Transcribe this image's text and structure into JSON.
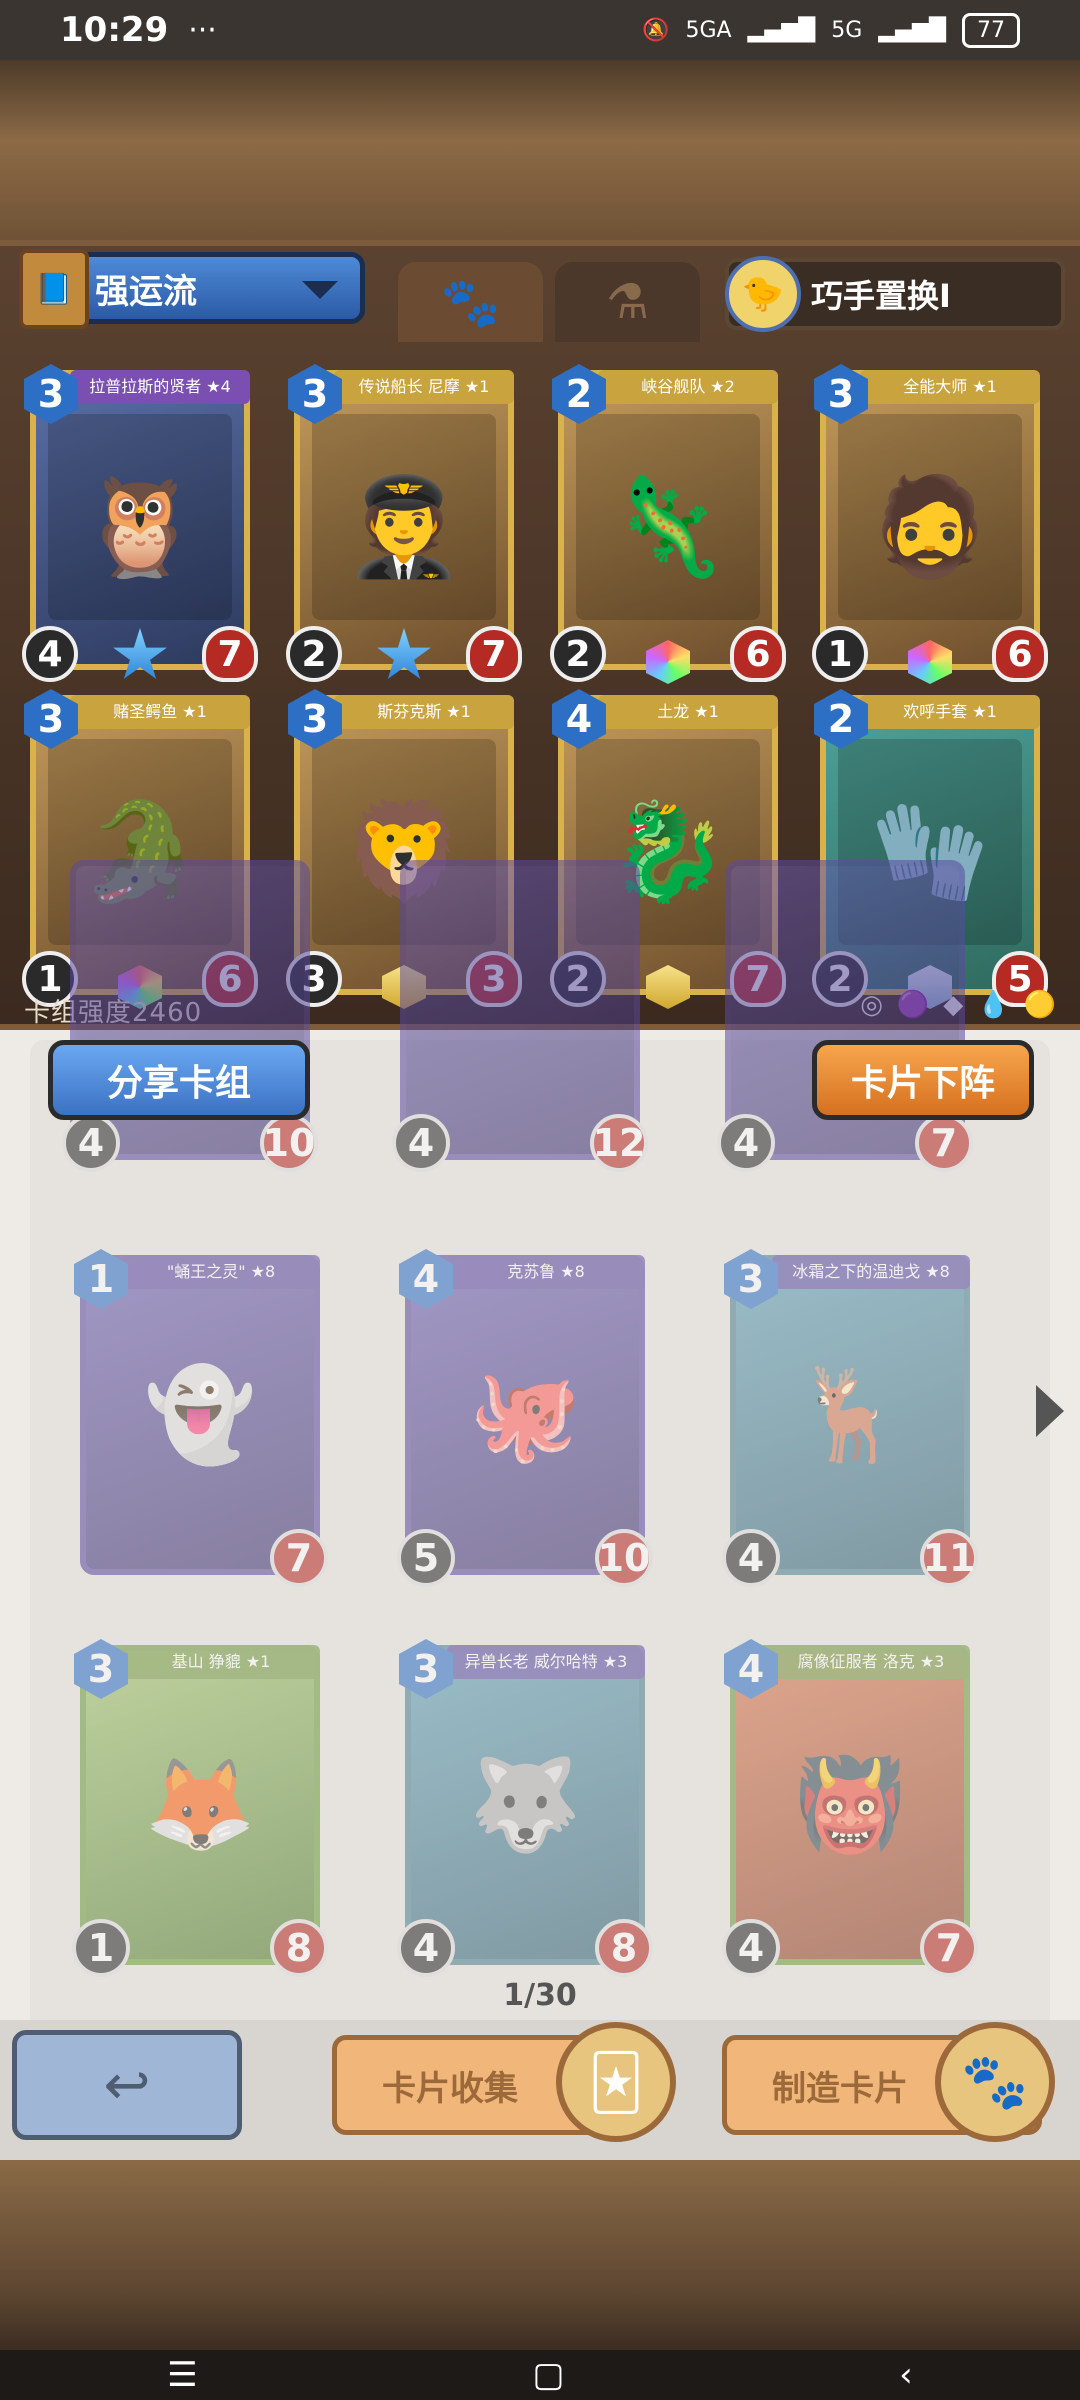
{
  "status_bar": {
    "time": "10:29",
    "dots": "···",
    "network1": "5GA",
    "network2": "5G",
    "battery": "77"
  },
  "deck": {
    "name": "强运流",
    "swap_label": "巧手置换I",
    "strength": "卡组强度2460"
  },
  "deck_cards": [
    {
      "cost": "3",
      "name": "拉普拉斯的贤者 ★4",
      "atk": "4",
      "hp": "7",
      "style": "purple",
      "figure": "🦉",
      "gem": "star"
    },
    {
      "cost": "3",
      "name": "传说船长 尼摩 ★1",
      "atk": "2",
      "hp": "7",
      "style": "gold",
      "figure": "🧑‍✈️",
      "gem": "star"
    },
    {
      "cost": "2",
      "name": "峡谷舰队 ★2",
      "atk": "2",
      "hp": "6",
      "style": "gold",
      "figure": "🦎",
      "gem": "rainbow"
    },
    {
      "cost": "3",
      "name": "全能大师 ★1",
      "atk": "1",
      "hp": "6",
      "style": "gold",
      "figure": "🧔",
      "gem": "rainbow"
    },
    {
      "cost": "3",
      "name": "赌圣鳄鱼 ★1",
      "atk": "1",
      "hp": "6",
      "style": "gold",
      "figure": "🐊",
      "gem": "rainbow"
    },
    {
      "cost": "3",
      "name": "斯芬克斯 ★1",
      "atk": "3",
      "hp": "3",
      "style": "gold",
      "figure": "🦁",
      "gem": "gold"
    },
    {
      "cost": "4",
      "name": "土龙 ★1",
      "atk": "2",
      "hp": "7",
      "style": "gold",
      "figure": "🐉",
      "gem": "gold"
    },
    {
      "cost": "2",
      "name": "欢呼手套 ★1",
      "atk": "2",
      "hp": "5",
      "style": "green",
      "figure": "🧤",
      "gem": "ice"
    }
  ],
  "buttons": {
    "share": "分享卡组",
    "remove": "卡片下阵",
    "collect": "卡片收集",
    "craft": "制造卡片",
    "back": "↩"
  },
  "collection_top_partial": [
    {
      "atk": "4",
      "hp": "10"
    },
    {
      "atk": "4",
      "hp": "12"
    },
    {
      "atk": "4",
      "hp": "7"
    }
  ],
  "collection_cards": [
    {
      "cost": "1",
      "name": "\"蛹王之灵\" ★8",
      "atk": "",
      "hp": "7",
      "style": "purple",
      "figure": "👻"
    },
    {
      "cost": "4",
      "name": "克苏鲁 ★8",
      "atk": "5",
      "hp": "10",
      "style": "purple",
      "figure": "🐙"
    },
    {
      "cost": "3",
      "name": "冰霜之下的温迪戈 ★8",
      "atk": "4",
      "hp": "11",
      "style": "teal",
      "figure": "🦌"
    },
    {
      "cost": "3",
      "name": "基山 狰貔 ★1",
      "atk": "1",
      "hp": "8",
      "style": "green",
      "figure": "🦊"
    },
    {
      "cost": "3",
      "name": "异兽长老 威尔哈特 ★3",
      "atk": "4",
      "hp": "8",
      "style": "teal",
      "figure": "🐺"
    },
    {
      "cost": "4",
      "name": "腐像征服者 洛克 ★3",
      "atk": "4",
      "hp": "7",
      "style": "red",
      "figure": "👹"
    }
  ],
  "page_indicator": "1/30",
  "icons": {
    "tab_paw": "paw-icon",
    "tab_potion": "potion-icon",
    "next": "chevron-right-icon",
    "back": "back-arrow-icon"
  }
}
